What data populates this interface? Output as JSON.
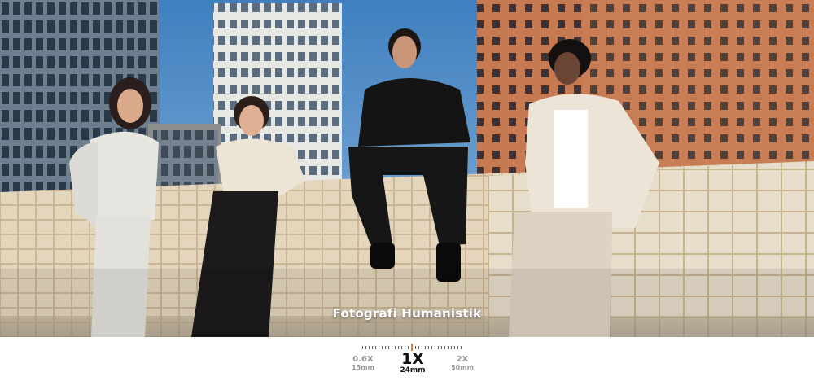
{
  "photo": {
    "caption": "Fotografi Humanistik",
    "description_icon": "photo-scene"
  },
  "zoom": {
    "options": [
      {
        "label": "0.6X",
        "focal": "15mm",
        "selected": false
      },
      {
        "label": "1X",
        "focal": "24mm",
        "selected": true
      },
      {
        "label": "2X",
        "focal": "50mm",
        "selected": false
      }
    ],
    "accent_color": "#d9823b"
  }
}
